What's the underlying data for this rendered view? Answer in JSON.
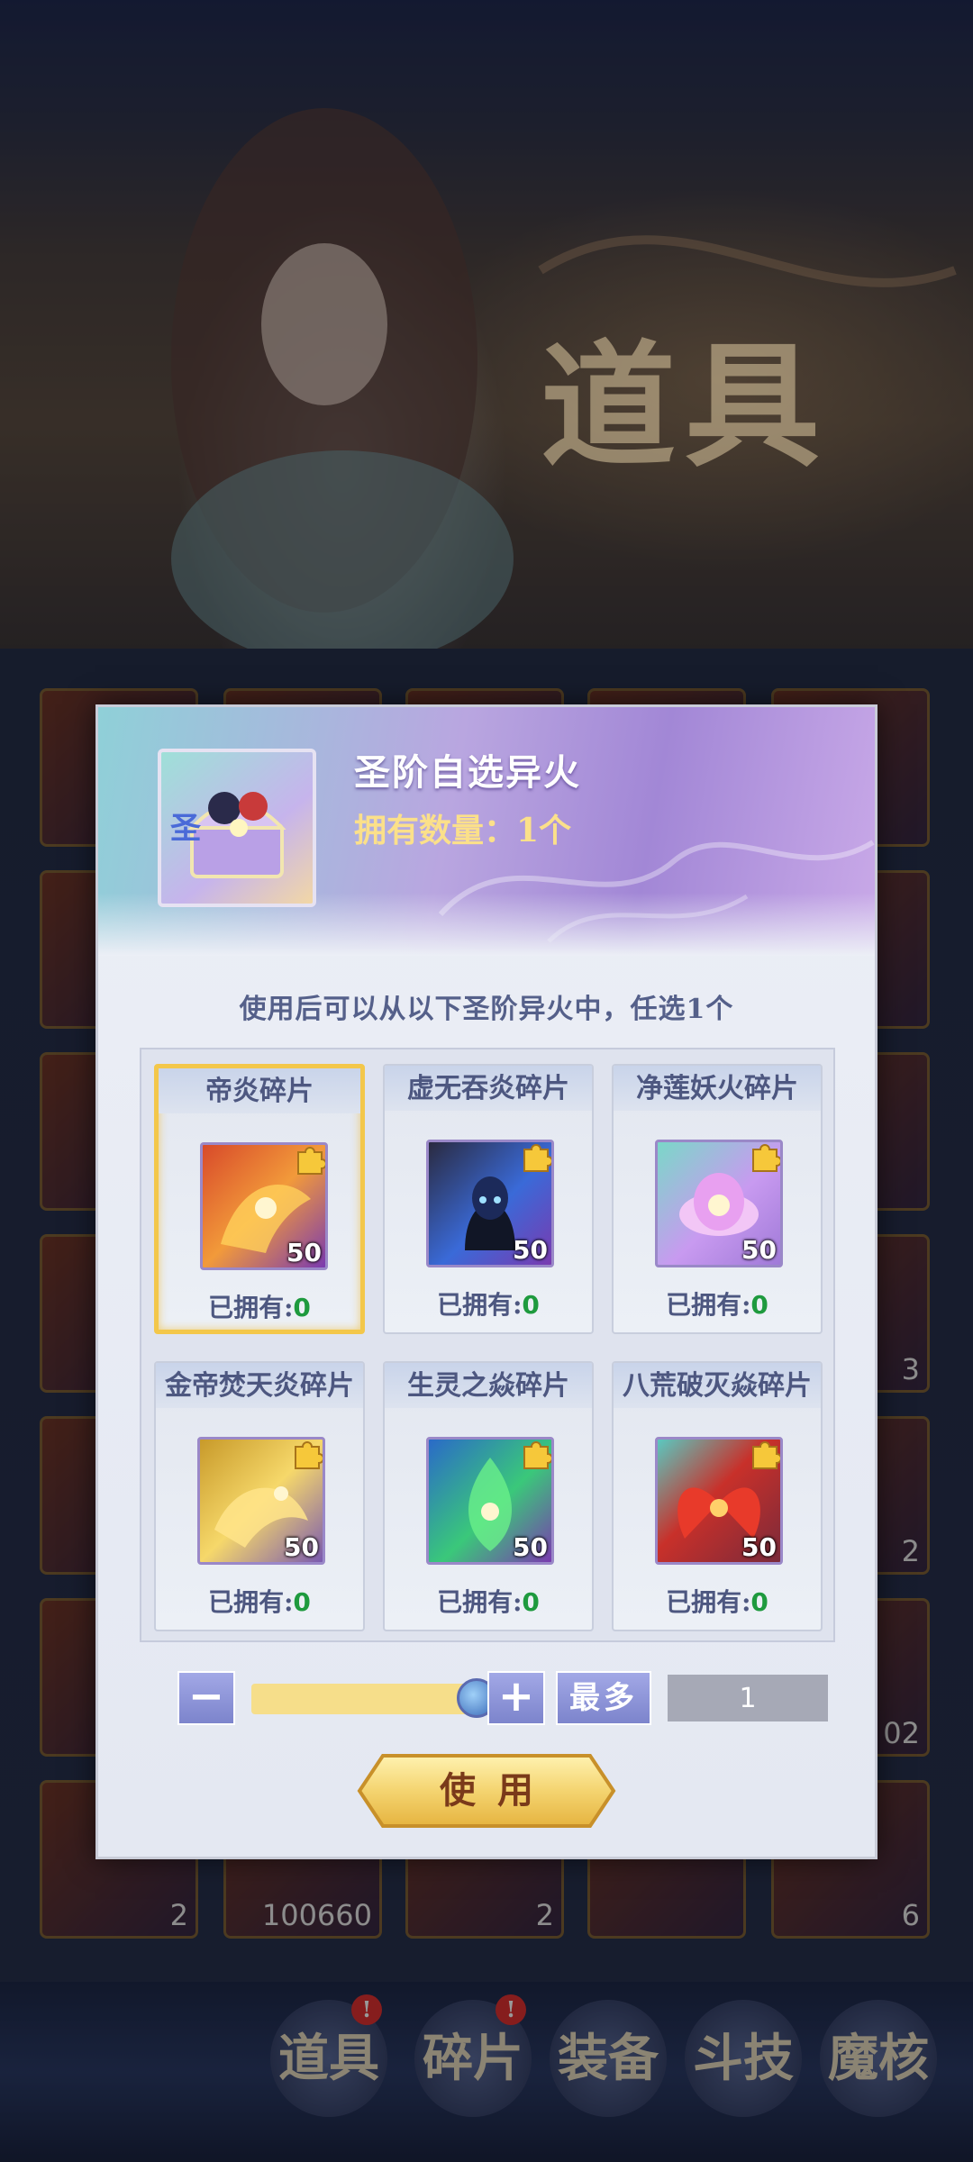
{
  "background": {
    "page_title": "道具",
    "grid_counts": [
      "3",
      "2",
      "02",
      "2",
      "100660",
      "2",
      "6"
    ],
    "tabs": [
      {
        "label": "道具",
        "badge": "!"
      },
      {
        "label": "碎片",
        "badge": "!"
      },
      {
        "label": "装备",
        "badge": ""
      },
      {
        "label": "斗技",
        "badge": ""
      },
      {
        "label": "魔核",
        "badge": ""
      }
    ]
  },
  "dialog": {
    "item_name": "圣阶自选异火",
    "item_count": "拥有数量：1个",
    "description": "使用后可以从以下圣阶异火中，任选1个",
    "options": [
      {
        "name": "帝炎碎片",
        "qty": "50",
        "owned_label": "已拥有:",
        "owned": "0",
        "selected": true,
        "icon": "flame-phoenix-icon"
      },
      {
        "name": "虚无吞炎碎片",
        "qty": "50",
        "owned_label": "已拥有:",
        "owned": "0",
        "selected": false,
        "icon": "hooded-figure-icon"
      },
      {
        "name": "净莲妖火碎片",
        "qty": "50",
        "owned_label": "已拥有:",
        "owned": "0",
        "selected": false,
        "icon": "lotus-flame-icon"
      },
      {
        "name": "金帝焚天炎碎片",
        "qty": "50",
        "owned_label": "已拥有:",
        "owned": "0",
        "selected": false,
        "icon": "golden-dragon-icon"
      },
      {
        "name": "生灵之焱碎片",
        "qty": "50",
        "owned_label": "已拥有:",
        "owned": "0",
        "selected": false,
        "icon": "green-flame-icon"
      },
      {
        "name": "八荒破灭焱碎片",
        "qty": "50",
        "owned_label": "已拥有:",
        "owned": "0",
        "selected": false,
        "icon": "red-wings-icon"
      }
    ],
    "controls": {
      "minus": "−",
      "plus": "+",
      "max_label": "最多",
      "quantity_value": "1",
      "slider_fraction": 1.0
    },
    "use_button": "使用"
  },
  "colors": {
    "accent_gold": "#f3c74a",
    "owned_green": "#1e9a3e",
    "label_blue": "#4d5780"
  }
}
